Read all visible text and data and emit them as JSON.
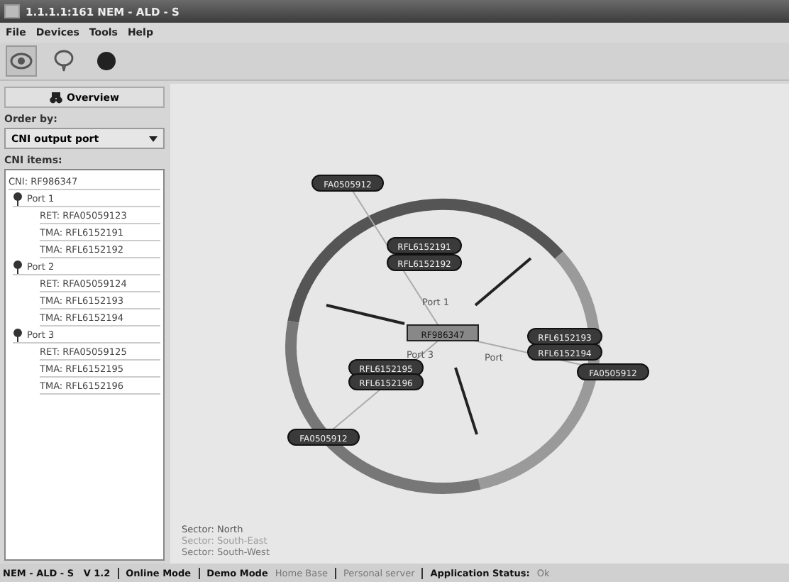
{
  "window": {
    "title": "1.1.1.1:161   NEM - ALD - S"
  },
  "menu": [
    "File",
    "Devices",
    "Tools",
    "Help"
  ],
  "toolbar": [
    {
      "kind": "eye",
      "selected": true
    },
    {
      "kind": "balloon",
      "selected": false
    },
    {
      "kind": "dot",
      "selected": false
    }
  ],
  "sidebar": {
    "overview_button": "Overview",
    "order_label": "Order by:",
    "order_value": "CNI output port",
    "items_label": "CNI items:",
    "tree": {
      "label": "CNI: RF986347",
      "children": [
        {
          "label": "Port 1",
          "expanded": true,
          "children": [
            {
              "label": "RET: RFA05059123"
            },
            {
              "label": "TMA: RFL6152191"
            },
            {
              "label": "TMA: RFL6152192"
            }
          ]
        },
        {
          "label": "Port 2",
          "expanded": true,
          "children": [
            {
              "label": "RET: RFA05059124"
            },
            {
              "label": "TMA: RFL6152193"
            },
            {
              "label": "TMA: RFL6152194"
            }
          ]
        },
        {
          "label": "Port 3",
          "expanded": true,
          "children": [
            {
              "label": "RET: RFA05059125"
            },
            {
              "label": "TMA: RFL6152195"
            },
            {
              "label": "TMA: RFL6152196"
            }
          ]
        }
      ]
    }
  },
  "diagram": {
    "center": "RF986347",
    "ports": [
      {
        "label": "Port 1",
        "ret": "FA0505912",
        "tmas": [
          "RFL6152191",
          "RFL6152192"
        ]
      },
      {
        "label": "Port",
        "ret": "FA0505912",
        "tmas": [
          "RFL6152193",
          "RFL6152194"
        ]
      },
      {
        "label": "Port 3",
        "ret": "FA0505912",
        "tmas": [
          "RFL6152195",
          "RFL6152196"
        ]
      }
    ],
    "sectors": [
      {
        "label": "Sector: North",
        "color": "#555555"
      },
      {
        "label": "Sector: South-East",
        "color": "#9a9a9a"
      },
      {
        "label": "Sector: South-West",
        "color": "#777777"
      }
    ]
  },
  "status_bar": [
    {
      "text": "NEM - ALD - S   V 1.2",
      "disabled": false
    },
    {
      "text": "Online Mode",
      "disabled": false
    },
    {
      "text": "Demo Mode",
      "disabled": false
    },
    {
      "text": "Home Base",
      "disabled": true
    },
    {
      "text": "Personal server",
      "disabled": true
    },
    {
      "text": "Application Status:",
      "disabled": false
    },
    {
      "text": "Ok",
      "disabled": true
    }
  ]
}
